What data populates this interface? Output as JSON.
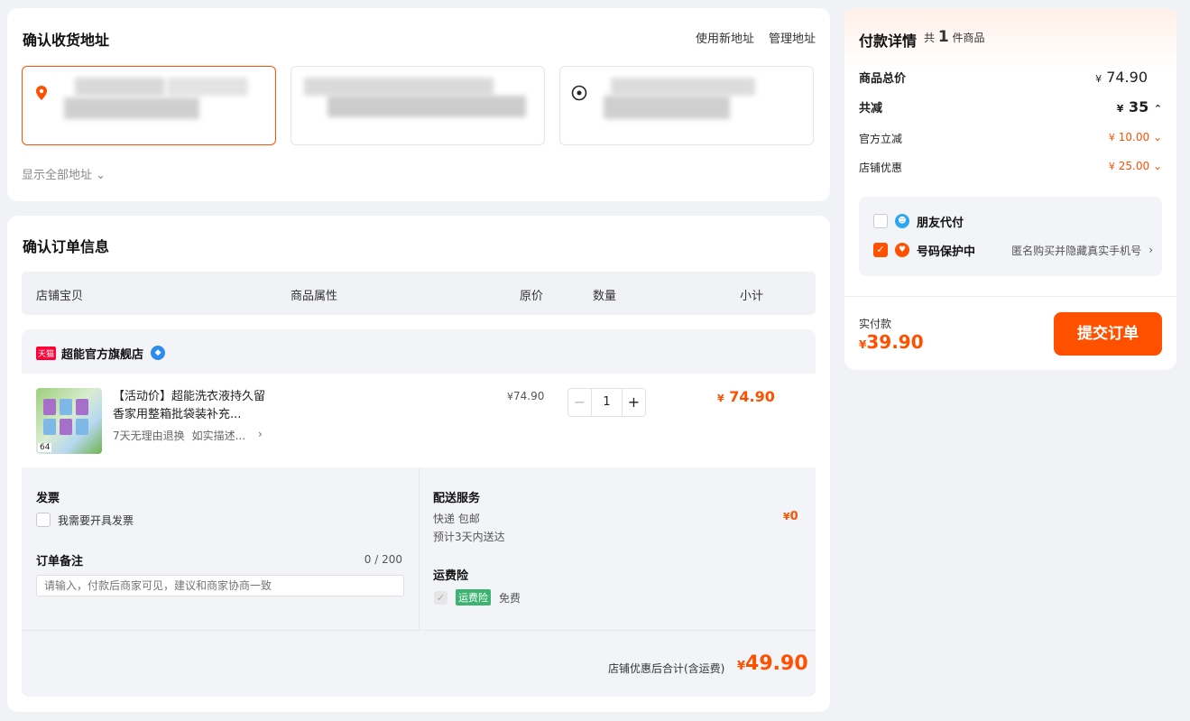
{
  "address": {
    "title": "确认收货地址",
    "new_address": "使用新地址",
    "manage_address": "管理地址",
    "show_all": "显示全部地址"
  },
  "order": {
    "title": "确认订单信息",
    "headers": [
      "店铺宝贝",
      "商品属性",
      "原价",
      "数量",
      "小计"
    ],
    "shop": {
      "badge": "天猫",
      "name": "超能官方旗舰店"
    },
    "item": {
      "title": "【活动价】超能洗衣液持久留香家用整箱批袋装补充...",
      "tags": [
        "7天无理由退换",
        "如实描述..."
      ],
      "thumb_label": "64",
      "price_symbol": "¥",
      "price": "74.90",
      "quantity": "1",
      "minus": "−",
      "plus": "+",
      "subtotal": "74.90"
    },
    "invoice": {
      "title": "发票",
      "option": "我需要开具发票"
    },
    "memo": {
      "title": "订单备注",
      "count": "0 / 200",
      "placeholder": "请输入，付款后商家可见，建议和商家协商一致"
    },
    "delivery": {
      "title": "配送服务",
      "method": "快递 包邮",
      "eta": "预计3天内送达",
      "fee": "0"
    },
    "insurance": {
      "title": "运费险",
      "tag": "运费险",
      "note": "免费"
    },
    "total": {
      "label": "店铺优惠后合计(含运费)",
      "value": "49.90"
    }
  },
  "pay": {
    "title": "付款详情",
    "count_prefix": "共",
    "count": "1",
    "count_suffix": "件商品",
    "goods_total_label": "商品总价",
    "goods_total": "74.90",
    "discount_label": "共减",
    "discount": "35",
    "official_label": "官方立减",
    "official": "10.00",
    "shop_label": "店铺优惠",
    "shop": "25.00",
    "friend_pay": "朋友代付",
    "phone_protect": "号码保护中",
    "phone_protect_desc": "匿名购买并隐藏真实手机号",
    "actual_label": "实付款",
    "actual": "39.90",
    "submit": "提交订单"
  },
  "colors": {
    "accent": "#ff5000",
    "green": "#3cb371",
    "tmall": "#ff0036"
  }
}
